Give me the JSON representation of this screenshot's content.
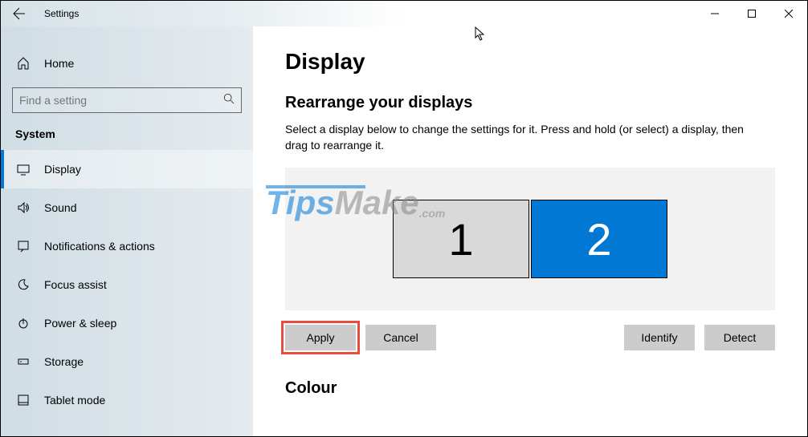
{
  "window": {
    "title": "Settings"
  },
  "sidebar": {
    "home_label": "Home",
    "search_placeholder": "Find a setting",
    "category": "System",
    "items": [
      {
        "label": "Display",
        "icon": "display-icon",
        "active": true
      },
      {
        "label": "Sound",
        "icon": "sound-icon",
        "active": false
      },
      {
        "label": "Notifications & actions",
        "icon": "notifications-icon",
        "active": false
      },
      {
        "label": "Focus assist",
        "icon": "moon-icon",
        "active": false
      },
      {
        "label": "Power & sleep",
        "icon": "power-icon",
        "active": false
      },
      {
        "label": "Storage",
        "icon": "storage-icon",
        "active": false
      },
      {
        "label": "Tablet mode",
        "icon": "tablet-icon",
        "active": false
      }
    ]
  },
  "main": {
    "title": "Display",
    "section1_title": "Rearrange your displays",
    "section1_desc": "Select a display below to change the settings for it. Press and hold (or select) a display, then drag to rearrange it.",
    "displays": [
      {
        "number": "1",
        "selected": false
      },
      {
        "number": "2",
        "selected": true
      }
    ],
    "buttons": {
      "apply": "Apply",
      "cancel": "Cancel",
      "identify": "Identify",
      "detect": "Detect"
    },
    "section2_title": "Colour"
  },
  "watermark": {
    "part1": "Tips",
    "part2": "Make",
    "suffix": ".com"
  }
}
